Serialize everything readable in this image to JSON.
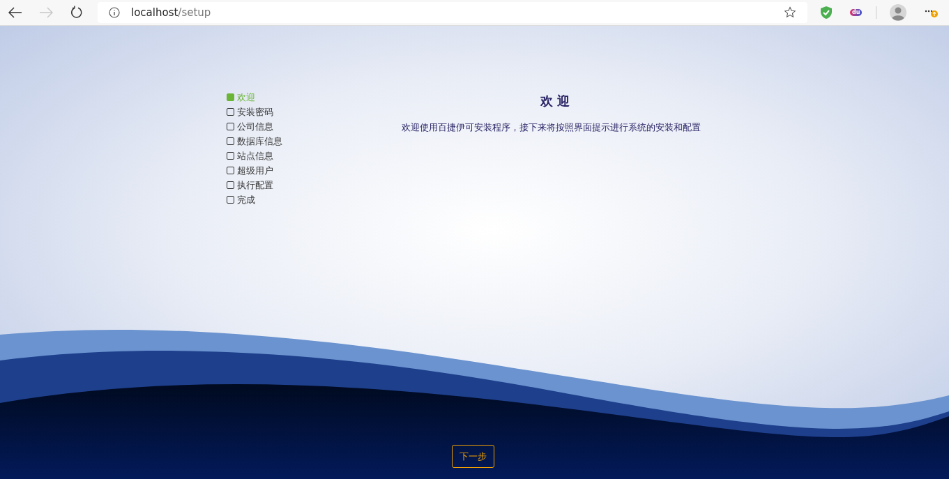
{
  "browser": {
    "back_disabled": false,
    "forward_disabled": true,
    "url_host": "localhost",
    "url_path": "/setup",
    "extension_label": "du"
  },
  "steps": [
    {
      "label": "欢迎",
      "selected": true
    },
    {
      "label": "安装密码",
      "selected": false
    },
    {
      "label": "公司信息",
      "selected": false
    },
    {
      "label": "数据库信息",
      "selected": false
    },
    {
      "label": "站点信息",
      "selected": false
    },
    {
      "label": "超级用户",
      "selected": false
    },
    {
      "label": "执行配置",
      "selected": false
    },
    {
      "label": "完成",
      "selected": false
    }
  ],
  "content": {
    "title": "欢 迎",
    "text": "欢迎使用百捷伊可安装程序，接下来将按照界面提示进行系统的安装和配置"
  },
  "next_button": "下一步"
}
